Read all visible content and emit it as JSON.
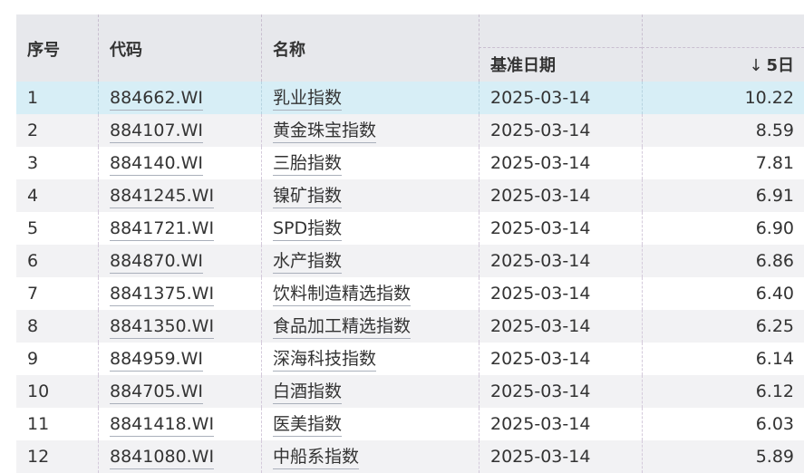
{
  "table": {
    "headers": {
      "index": "序号",
      "code": "代码",
      "name": "名称",
      "date": "基准日期",
      "value": "5日",
      "sort_icon": "↓"
    },
    "rows": [
      {
        "index": "1",
        "code": "884662.WI",
        "name": "乳业指数",
        "date": "2025-03-14",
        "value": "10.22"
      },
      {
        "index": "2",
        "code": "884107.WI",
        "name": "黄金珠宝指数",
        "date": "2025-03-14",
        "value": "8.59"
      },
      {
        "index": "3",
        "code": "884140.WI",
        "name": "三胎指数",
        "date": "2025-03-14",
        "value": "7.81"
      },
      {
        "index": "4",
        "code": "8841245.WI",
        "name": "镍矿指数",
        "date": "2025-03-14",
        "value": "6.91"
      },
      {
        "index": "5",
        "code": "8841721.WI",
        "name": "SPD指数",
        "date": "2025-03-14",
        "value": "6.90"
      },
      {
        "index": "6",
        "code": "884870.WI",
        "name": "水产指数",
        "date": "2025-03-14",
        "value": "6.86"
      },
      {
        "index": "7",
        "code": "8841375.WI",
        "name": "饮料制造精选指数",
        "date": "2025-03-14",
        "value": "6.40"
      },
      {
        "index": "8",
        "code": "8841350.WI",
        "name": "食品加工精选指数",
        "date": "2025-03-14",
        "value": "6.25"
      },
      {
        "index": "9",
        "code": "884959.WI",
        "name": "深海科技指数",
        "date": "2025-03-14",
        "value": "6.14"
      },
      {
        "index": "10",
        "code": "884705.WI",
        "name": "白酒指数",
        "date": "2025-03-14",
        "value": "6.12"
      },
      {
        "index": "11",
        "code": "8841418.WI",
        "name": "医美指数",
        "date": "2025-03-14",
        "value": "6.03"
      },
      {
        "index": "12",
        "code": "8841080.WI",
        "name": "中船系指数",
        "date": "2025-03-14",
        "value": "5.89"
      }
    ]
  },
  "colors": {
    "header_bg": "#e7e8ec",
    "selected_row_bg": "#d7eef6",
    "stripe_bg": "#f2f2f4",
    "text": "#333333"
  }
}
